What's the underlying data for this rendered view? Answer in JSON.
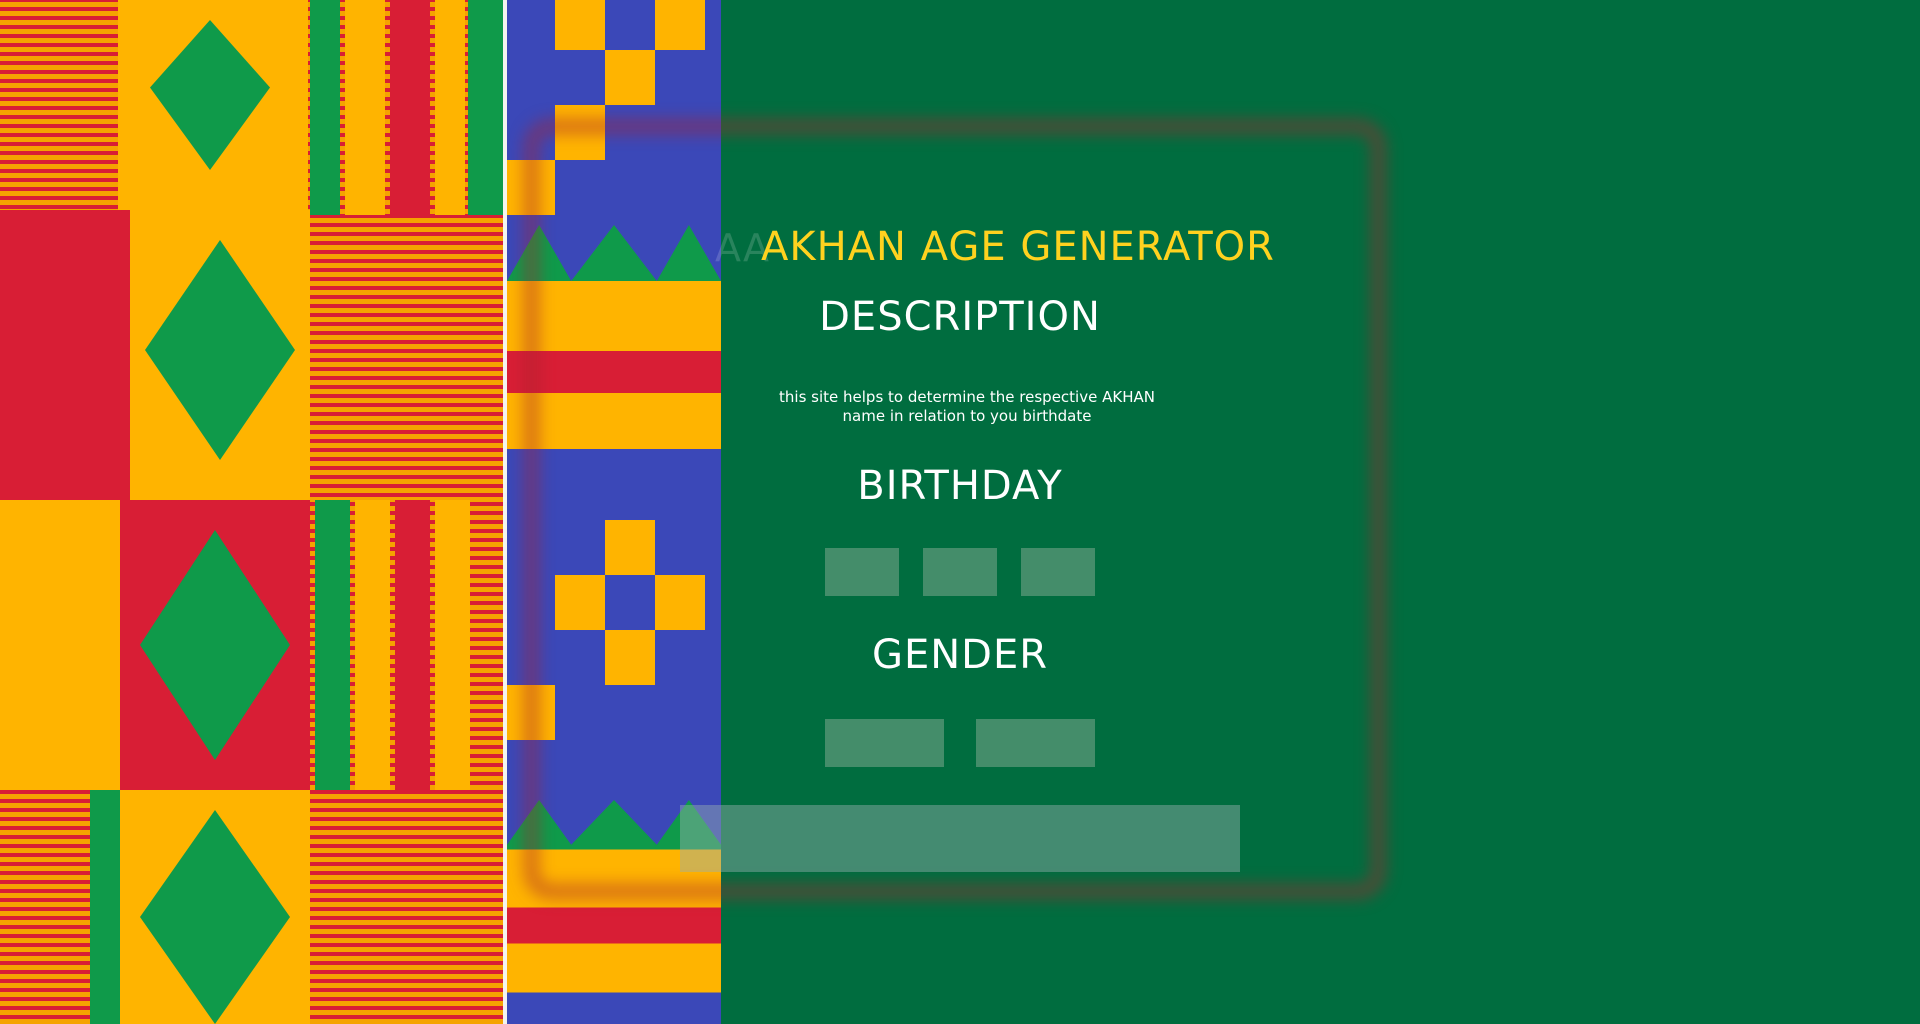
{
  "header": {
    "title": "AKHAN AGE GENERATOR",
    "title_ghost": "AA"
  },
  "description": {
    "heading": "DESCRIPTION",
    "text": "this site helps to determine the respective AKHAN name in relation to you birthdate"
  },
  "birthday": {
    "heading": "BIRTHDAY",
    "fields": [
      {
        "value": ""
      },
      {
        "value": ""
      },
      {
        "value": ""
      }
    ]
  },
  "gender": {
    "heading": "GENDER",
    "fields": [
      {
        "value": ""
      },
      {
        "value": ""
      }
    ]
  },
  "submit": {
    "label": ""
  },
  "colors": {
    "background": "#006d3f",
    "title": "#ffd21f",
    "text": "#ffffff",
    "kente_red": "#d81e35",
    "kente_gold": "#f5a300",
    "kente_green": "#0f9a4a",
    "kente_blue": "#3b48b8"
  }
}
